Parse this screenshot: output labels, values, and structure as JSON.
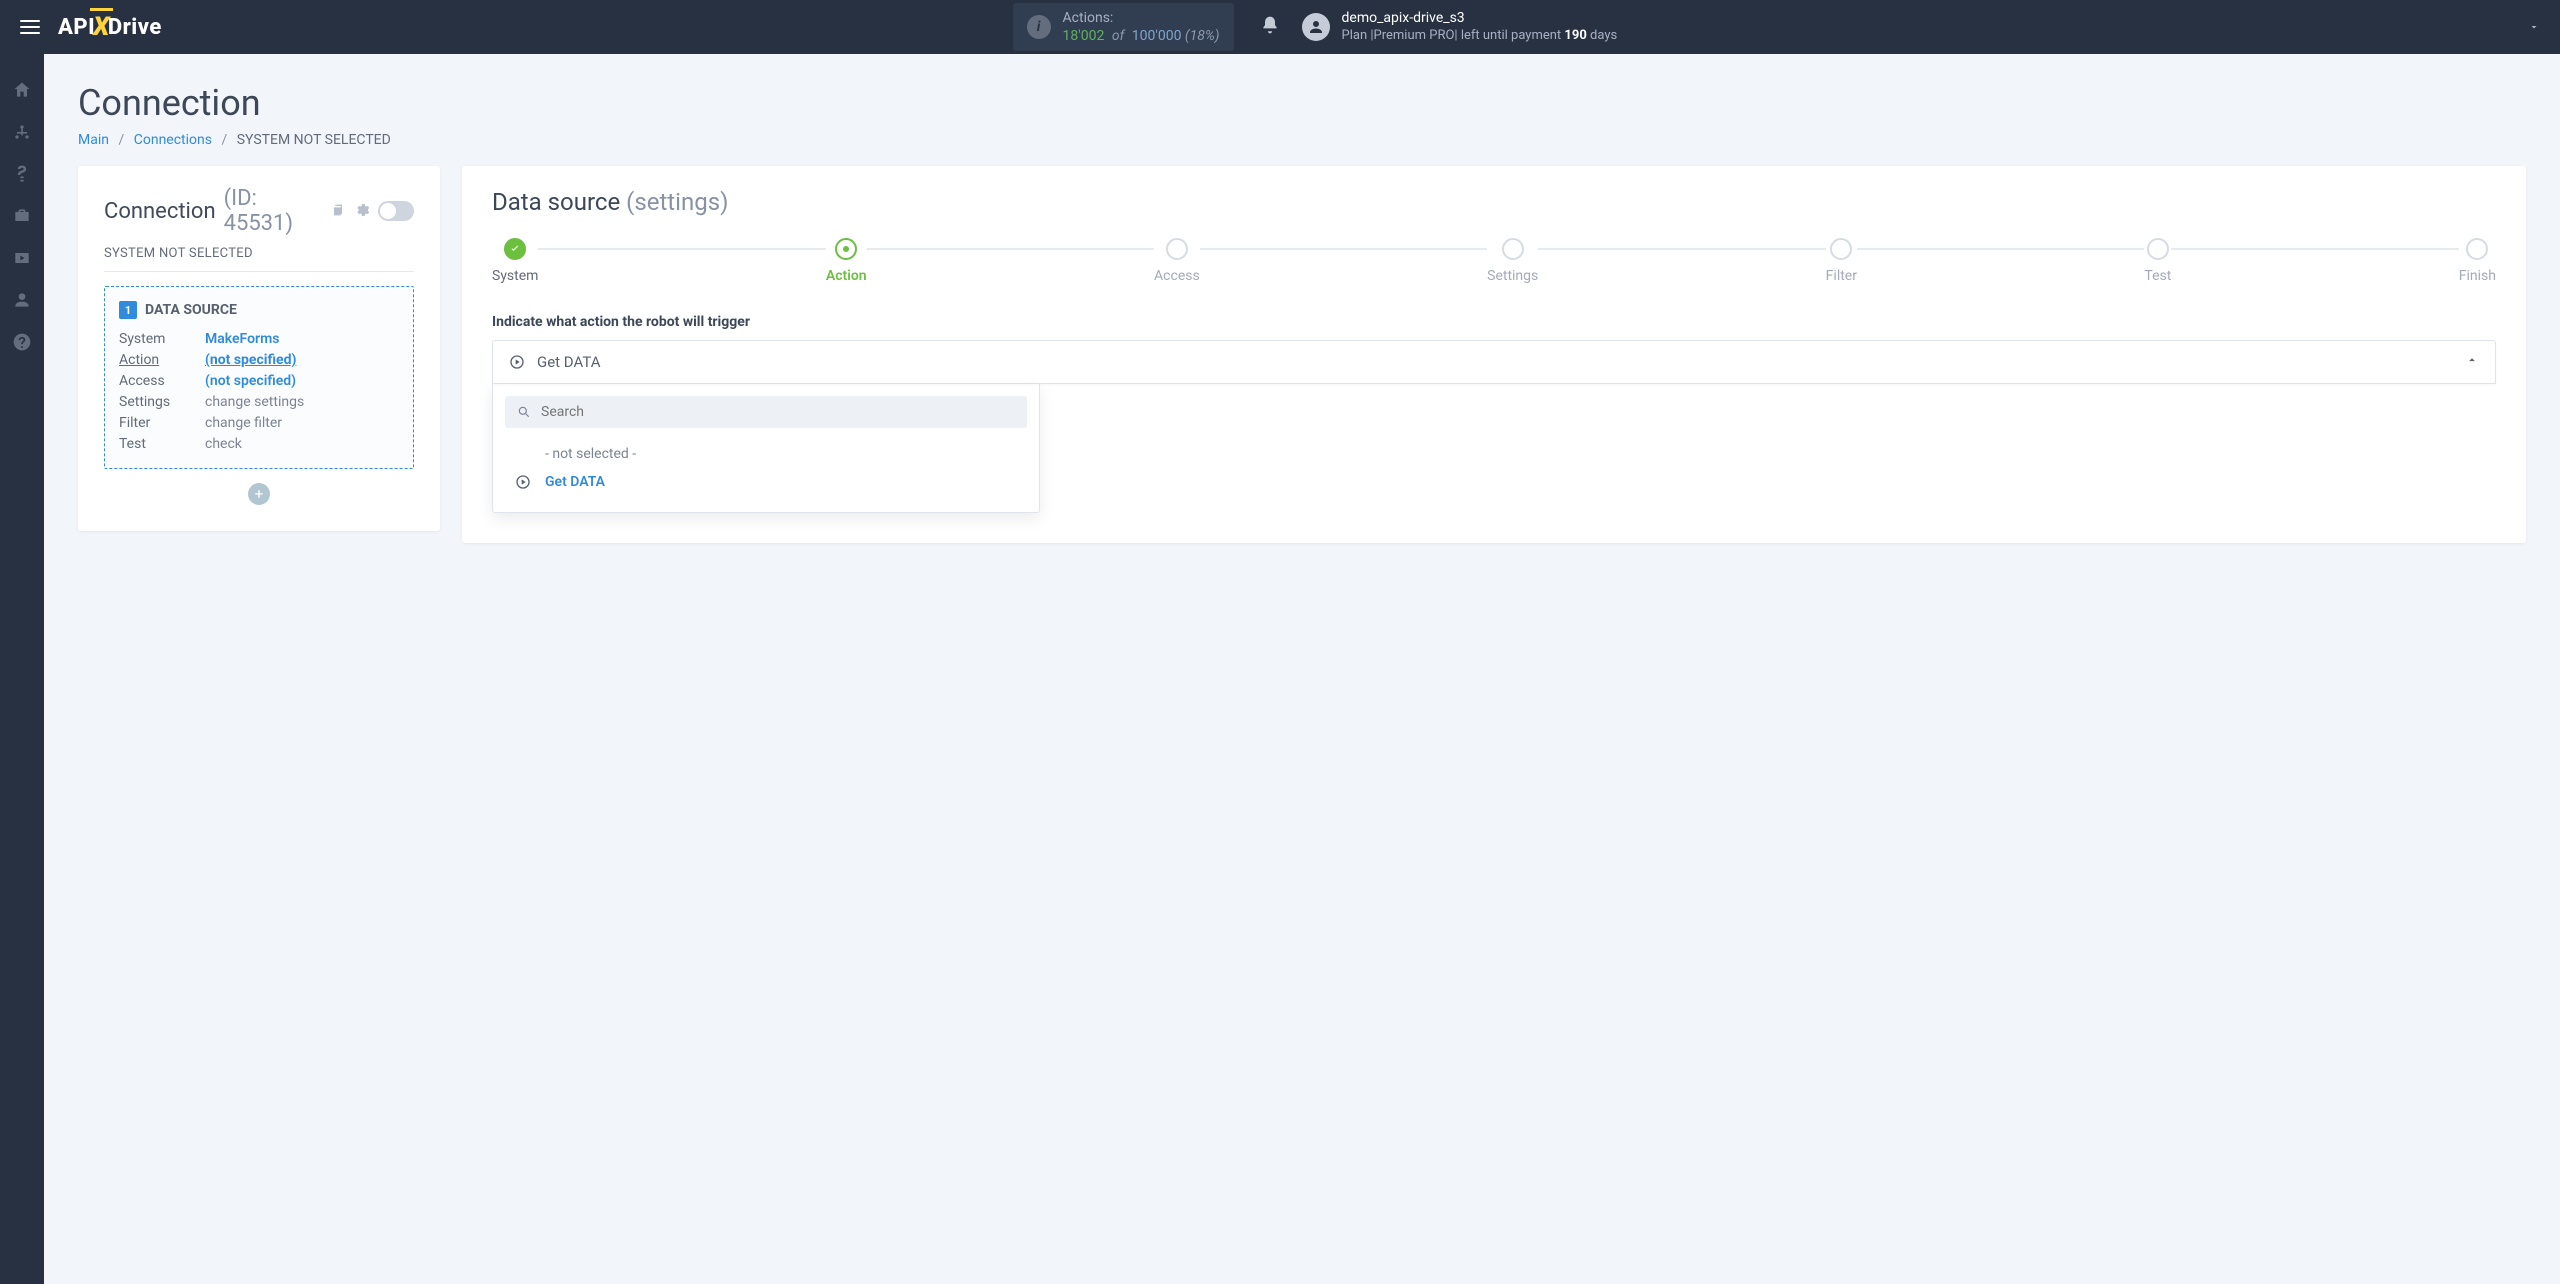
{
  "header": {
    "logo_left": "API",
    "logo_right": "Drive",
    "actions": {
      "label": "Actions:",
      "used": "18'002",
      "of": "of",
      "total": "100'000",
      "pct": "(18%)"
    },
    "user": {
      "name": "demo_apix-drive_s3",
      "plan_prefix": "Plan |",
      "plan_name": "Premium PRO",
      "plan_mid": "| left until payment ",
      "plan_days": "190",
      "plan_suffix": " days"
    }
  },
  "page": {
    "title": "Connection",
    "breadcrumb": {
      "main": "Main",
      "connections": "Connections",
      "current": "SYSTEM NOT SELECTED"
    }
  },
  "left": {
    "title": "Connection",
    "id_label": "(ID: 45531)",
    "subtitle": "SYSTEM NOT SELECTED",
    "ds_badge": "1",
    "ds_title": "DATA SOURCE",
    "rows": {
      "system": {
        "k": "System",
        "v": "MakeForms"
      },
      "action": {
        "k": "Action",
        "v": "(not specified)"
      },
      "access": {
        "k": "Access",
        "v": "(not specified)"
      },
      "settings": {
        "k": "Settings",
        "v": "change settings"
      },
      "filter": {
        "k": "Filter",
        "v": "change filter"
      },
      "test": {
        "k": "Test",
        "v": "check"
      }
    }
  },
  "right": {
    "title_main": "Data source",
    "title_grey": "(settings)",
    "steps": [
      "System",
      "Action",
      "Access",
      "Settings",
      "Filter",
      "Test",
      "Finish"
    ],
    "section_label": "Indicate what action the robot will trigger",
    "select_value": "Get DATA",
    "search_placeholder": "Search",
    "opt_notselected": "- not selected -",
    "opt_getdata": "Get DATA"
  }
}
